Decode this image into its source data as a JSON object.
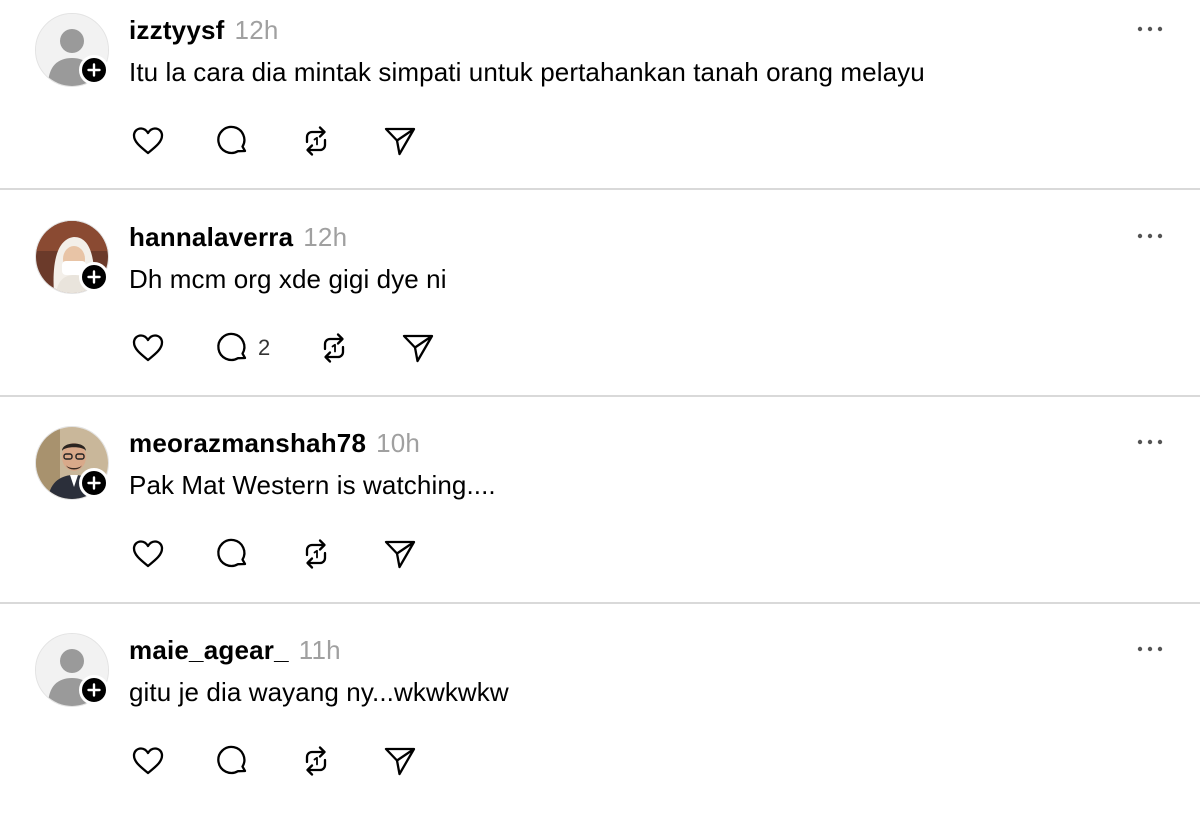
{
  "posts": [
    {
      "username": "izztyysf",
      "time": "12h",
      "text": "Itu la cara dia mintak simpati untuk pertahankan tanah orang melayu",
      "reply_count": "",
      "avatar": "default-avatar"
    },
    {
      "username": "hannalaverra",
      "time": "12h",
      "text": "Dh mcm org xde gigi dye ni",
      "reply_count": "2",
      "avatar": "photo-hijab"
    },
    {
      "username": "meorazmanshah78",
      "time": "10h",
      "text": "Pak Mat Western is watching....",
      "reply_count": "",
      "avatar": "photo-man-glasses"
    },
    {
      "username": "maie_agear_",
      "time": "11h",
      "text": "gitu je dia wayang ny...wkwkwkw",
      "reply_count": "",
      "avatar": "default-avatar"
    }
  ],
  "icons": {
    "like": "heart-icon",
    "reply": "comment-icon",
    "repost": "repost-icon",
    "share": "send-icon",
    "more": "more-icon",
    "follow": "plus-icon"
  },
  "colors": {
    "text": "#000000",
    "muted": "#a0a0a0",
    "divider": "#d9d9d9",
    "icon": "#000000"
  }
}
